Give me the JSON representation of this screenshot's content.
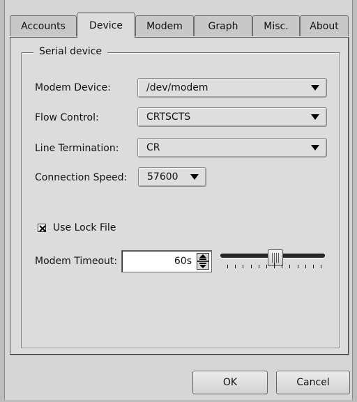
{
  "tabs": [
    {
      "label": "Accounts",
      "active": false
    },
    {
      "label": "Device",
      "active": true
    },
    {
      "label": "Modem",
      "active": false
    },
    {
      "label": "Graph",
      "active": false
    },
    {
      "label": "Misc.",
      "active": false
    },
    {
      "label": "About",
      "active": false
    }
  ],
  "group": {
    "title": "Serial device"
  },
  "fields": {
    "modem_device": {
      "label": "Modem Device:",
      "value": "/dev/modem"
    },
    "flow_control": {
      "label": "Flow Control:",
      "value": "CRTSCTS"
    },
    "line_termination": {
      "label": "Line Termination:",
      "value": "CR"
    },
    "connection_speed": {
      "label": "Connection Speed:",
      "value": "57600"
    },
    "lock_file": {
      "label": "Use Lock File",
      "checked": true
    },
    "modem_timeout": {
      "label": "Modem Timeout:",
      "value": "60s",
      "slider_fraction": 0.53
    }
  },
  "buttons": {
    "ok": "OK",
    "cancel": "Cancel"
  },
  "icons": {
    "combo_arrow": "chevron-down-icon",
    "check": "checkmark-icon",
    "spin_up": "spin-up-icon",
    "spin_down": "spin-down-icon"
  }
}
